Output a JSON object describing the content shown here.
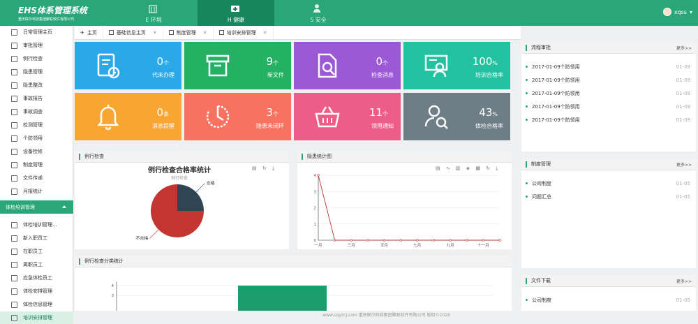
{
  "header": {
    "logo_title": "EHS体系管理系统",
    "logo_sub": "重庆联尔科技集团聚联软件有限公司",
    "username": "xqss",
    "nav": [
      {
        "label": "E 环境",
        "icon": "building-icon"
      },
      {
        "label": "H 健康",
        "icon": "medkit-icon",
        "active": true
      },
      {
        "label": "S 安全",
        "icon": "person-shield-icon"
      }
    ]
  },
  "sidebar": {
    "items": [
      "日常管理主页",
      "审批管理",
      "例行检查",
      "隐患管理",
      "隐患整改",
      "事故报告",
      "事故调查",
      "检测管理",
      "个防领用",
      "设备检修",
      "制度管理",
      "文件传递",
      "月报统计"
    ],
    "group": "体检培训管理",
    "sub_items": [
      "体检培训管理...",
      "新入职员工",
      "在职员工",
      "离职员工",
      "应急体检员工",
      "体检安排管理",
      "体检信息管理",
      "培训安排管理"
    ]
  },
  "tabs": [
    {
      "label": "主页"
    },
    {
      "label": "基础信息主页"
    },
    {
      "label": "制度管理"
    },
    {
      "label": "培训安排管理"
    }
  ],
  "tiles": [
    {
      "num": "0",
      "unit": "个",
      "caption": "代未办理",
      "color": "#2ba8e8",
      "icon": "document-clock-icon"
    },
    {
      "num": "9",
      "unit": "个",
      "caption": "新文件",
      "color": "#24b163",
      "icon": "archive-box-icon"
    },
    {
      "num": "0",
      "unit": "个",
      "caption": "检查消息",
      "color": "#9b59d6",
      "icon": "document-search-icon"
    },
    {
      "num": "100",
      "unit": "%",
      "caption": "培训合格率",
      "color": "#22c2a0",
      "icon": "presentation-icon"
    },
    {
      "num": "0",
      "unit": "条",
      "caption": "消息提醒",
      "color": "#f7a632",
      "icon": "bell-icon"
    },
    {
      "num": "3",
      "unit": "个",
      "caption": "隐患未闭环",
      "color": "#f9715f",
      "icon": "timer-icon"
    },
    {
      "num": "11",
      "unit": "个",
      "caption": "领用通知",
      "color": "#ee5c8a",
      "icon": "basket-icon"
    },
    {
      "num": "43",
      "unit": "%",
      "caption": "体检合格率",
      "color": "#6e7d86",
      "icon": "users-search-icon"
    }
  ],
  "panels": {
    "routine": "例行检查",
    "hazard": "隐患统计图",
    "category": "例行检查分类统计"
  },
  "chart_data": [
    {
      "type": "pie",
      "title": "例行检查合格率统计",
      "subtitle": "例行检查",
      "labels": [
        "合格",
        "不合格"
      ],
      "values": [
        25,
        75
      ],
      "colors": [
        "#2f4554",
        "#c23531"
      ]
    },
    {
      "type": "line",
      "categories": [
        "一月",
        "三月",
        "五月",
        "七月",
        "九月",
        "十一月"
      ],
      "x": [
        1,
        2,
        3,
        4,
        5,
        6,
        7,
        8,
        9,
        10,
        11,
        12
      ],
      "values": [
        4,
        0,
        0,
        0,
        0,
        0,
        0,
        0,
        0,
        0,
        0,
        0
      ],
      "ylim": [
        0,
        4
      ],
      "yticks": [
        0,
        1,
        2,
        3,
        4
      ],
      "color": "#c23531"
    },
    {
      "type": "bar",
      "values": [
        4
      ],
      "color": "#1a9e6e",
      "yticks": [
        3,
        4
      ]
    }
  ],
  "right": {
    "flow": {
      "title": "流程审批",
      "more": "更多>>",
      "items": [
        {
          "t": "2017-01-09个防领用",
          "d": "01-09"
        },
        {
          "t": "2017-01-09个防领用",
          "d": "01-09"
        },
        {
          "t": "2017-01-09个防领用",
          "d": "01-09"
        },
        {
          "t": "2017-01-09个防领用",
          "d": "01-09"
        },
        {
          "t": "2017-01-09个防领用",
          "d": "01-09"
        }
      ]
    },
    "policy": {
      "title": "制度管理",
      "more": "更多>>",
      "items": [
        {
          "t": "公司制度",
          "d": "01-05"
        },
        {
          "t": "问题汇总",
          "d": "01-05"
        }
      ]
    },
    "files": {
      "title": "文件下载",
      "more": "更多>>",
      "items": [
        {
          "t": "公司制度",
          "d": "01-05"
        }
      ]
    }
  },
  "footer": {
    "text": "www.cqyzcj.com  重庆联尔科技集团聚联软件有限公司  版权©2016"
  }
}
